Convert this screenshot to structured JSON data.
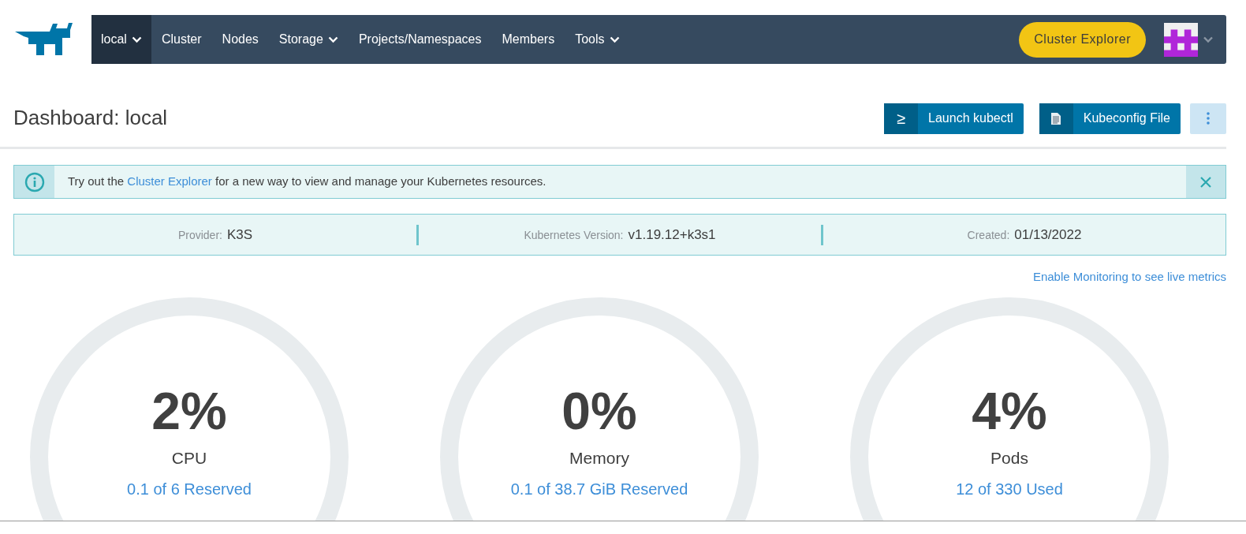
{
  "nav": {
    "items": [
      {
        "label": "local",
        "selected": true,
        "dropdown": true
      },
      {
        "label": "Cluster",
        "selected": false,
        "dropdown": false
      },
      {
        "label": "Nodes",
        "selected": false,
        "dropdown": false
      },
      {
        "label": "Storage",
        "selected": false,
        "dropdown": true
      },
      {
        "label": "Projects/Namespaces",
        "selected": false,
        "dropdown": false
      },
      {
        "label": "Members",
        "selected": false,
        "dropdown": false
      },
      {
        "label": "Tools",
        "selected": false,
        "dropdown": true
      }
    ],
    "explorer_button": "Cluster Explorer"
  },
  "header": {
    "title": "Dashboard: local",
    "buttons": [
      {
        "kind": "terminal",
        "label": "Launch kubectl",
        "icon_text": "≥"
      },
      {
        "kind": "file",
        "label": "Kubeconfig File"
      }
    ]
  },
  "alert": {
    "text_before": "Try out the ",
    "link": "Cluster Explorer",
    "text_after": " for a new way to view and manage your Kubernetes resources."
  },
  "info": [
    {
      "label": "Provider:",
      "value": "K3S"
    },
    {
      "label": "Kubernetes Version:",
      "value": "v1.19.12+k3s1"
    },
    {
      "label": "Created:",
      "value": "01/13/2022"
    }
  ],
  "monitoring_link": "Enable Monitoring to see live metrics",
  "gauges": [
    {
      "percent": "2%",
      "name": "CPU",
      "detail": "0.1 of 6 Reserved"
    },
    {
      "percent": "0%",
      "name": "Memory",
      "detail": "0.1 of 38.7 GiB Reserved"
    },
    {
      "percent": "4%",
      "name": "Pods",
      "detail": "12 of 330 Used"
    }
  ]
}
